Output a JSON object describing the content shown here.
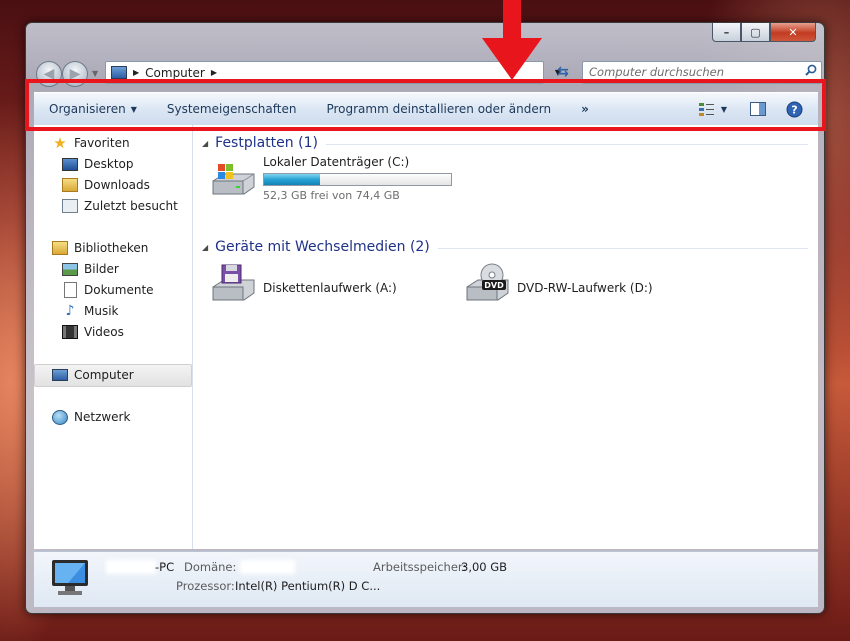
{
  "window": {
    "controls": {
      "minimize": "–",
      "maximize": "▢",
      "close": "✕"
    }
  },
  "address": {
    "crumbs": [
      "Computer"
    ],
    "search_placeholder": "Computer durchsuchen"
  },
  "toolbar": {
    "organize": "Organisieren",
    "system_properties": "Systemeigenschaften",
    "uninstall": "Programm deinstallieren oder ändern",
    "more": "»"
  },
  "navpane": {
    "favorites": {
      "label": "Favoriten",
      "items": [
        "Desktop",
        "Downloads",
        "Zuletzt besucht"
      ]
    },
    "libraries": {
      "label": "Bibliotheken",
      "items": [
        "Bilder",
        "Dokumente",
        "Musik",
        "Videos"
      ]
    },
    "computer": "Computer",
    "network": "Netzwerk"
  },
  "groups": [
    {
      "title": "Festplatten (1)"
    },
    {
      "title": "Geräte mit Wechselmedien (2)"
    }
  ],
  "drives": {
    "c": {
      "label": "Lokaler Datenträger (C:)",
      "free_text": "52,3 GB frei von 74,4 GB",
      "used_fraction": 0.297
    },
    "a": {
      "label": "Diskettenlaufwerk (A:)"
    },
    "d": {
      "label": "DVD-RW-Laufwerk (D:)",
      "badge": "DVD"
    }
  },
  "details": {
    "pc_suffix": "-PC",
    "domain_label": "Domäne:",
    "memory_label": "Arbeitsspeicher:",
    "memory_value": "3,00 GB",
    "cpu_label": "Prozessor:",
    "cpu_value": "Intel(R) Pentium(R) D C..."
  },
  "colors": {
    "highlight": "#e8161c",
    "group_title": "#1e3287",
    "toolbar_text": "#1e395b"
  }
}
